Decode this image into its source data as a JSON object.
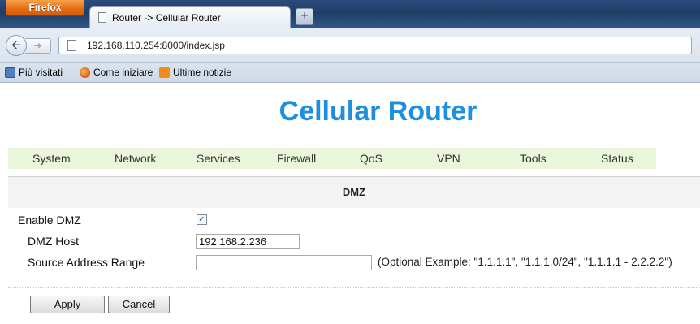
{
  "browser": {
    "app_button": "Firefox",
    "tab_title": "Router -> Cellular Router",
    "new_tab": "+",
    "url": "192.168.110.254:8000/index.jsp",
    "bookmarks": [
      "Più visitati",
      "Come iniziare",
      "Ultime notizie"
    ]
  },
  "page": {
    "title": "Cellular Router",
    "menu": [
      "System",
      "Network",
      "Services",
      "Firewall",
      "QoS",
      "VPN",
      "Tools",
      "Status"
    ],
    "section_title": "DMZ"
  },
  "form": {
    "enable_label": "Enable DMZ",
    "enable_checked": true,
    "host_label": "DMZ Host",
    "host_value": "192.168.2.236",
    "range_label": "Source Address Range",
    "range_value": "",
    "range_hint": "(Optional Example: \"1.1.1.1\", \"1.1.1.0/24\", \"1.1.1.1 - 2.2.2.2\")",
    "apply": "Apply",
    "cancel": "Cancel"
  }
}
